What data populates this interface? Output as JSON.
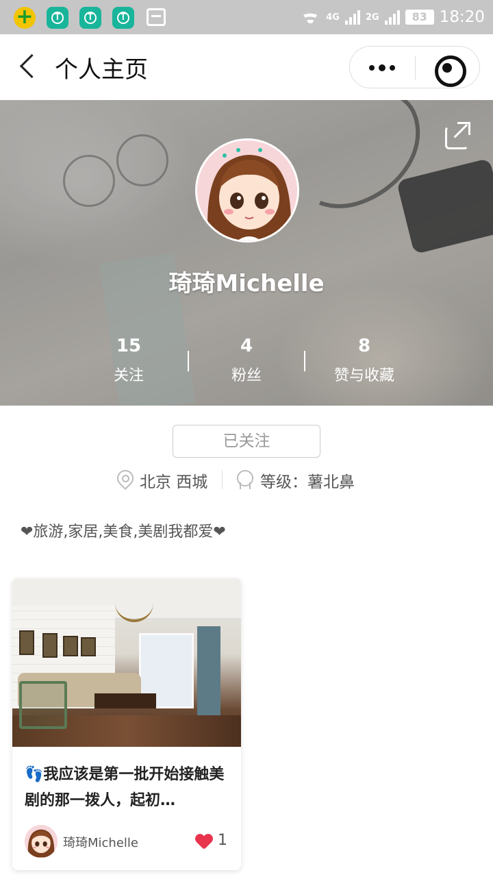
{
  "statusbar": {
    "network1": "4G",
    "network2": "2G",
    "battery": "83",
    "time": "18:20"
  },
  "header": {
    "title": "个人主页"
  },
  "profile": {
    "name": "琦琦Michelle",
    "stats": [
      {
        "value": "15",
        "label": "关注"
      },
      {
        "value": "4",
        "label": "粉丝"
      },
      {
        "value": "8",
        "label": "赞与收藏"
      }
    ],
    "follow_label": "已关注",
    "location": "北京 西城",
    "level": "等级：薯北鼻",
    "bio": "❤旅游,家居,美食,美剧我都爱❤"
  },
  "posts": [
    {
      "title": "👣我应该是第一批开始接触美剧的那一拨人，起初…",
      "author": "琦琦Michelle",
      "likes": "1"
    }
  ],
  "colors": {
    "like": "#e8344c",
    "statusbar": "#c6c6c6"
  }
}
